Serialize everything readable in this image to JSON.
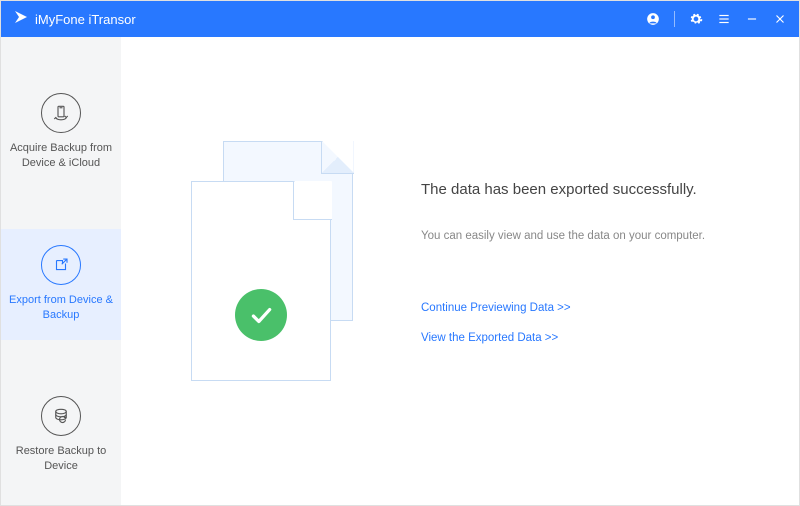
{
  "app": {
    "title": "iMyFone iTransor"
  },
  "sidebar": {
    "items": [
      {
        "label": "Acquire Backup from Device & iCloud"
      },
      {
        "label": "Export from Device & Backup"
      },
      {
        "label": "Restore Backup to Device"
      }
    ]
  },
  "main": {
    "heading": "The data has been exported successfully.",
    "sub": "You can easily view and use the data on your computer.",
    "link_continue": "Continue Previewing Data >>",
    "link_view": "View the Exported Data >>"
  },
  "colors": {
    "primary": "#2878ff",
    "success": "#4ac06a"
  }
}
